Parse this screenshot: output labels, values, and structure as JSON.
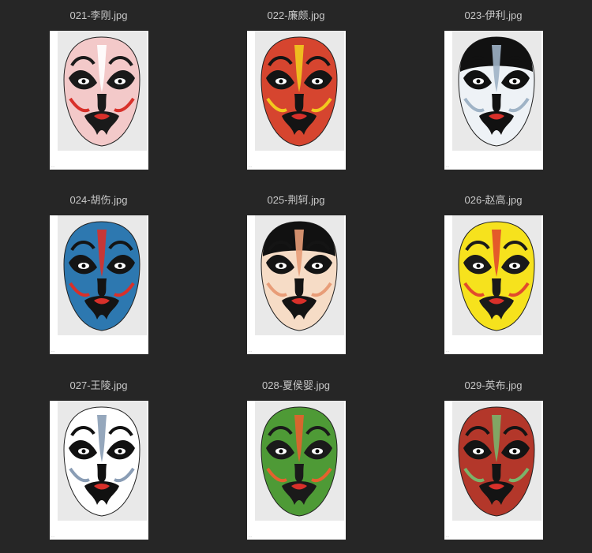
{
  "files": [
    {
      "name": "021-李刚.jpg",
      "base": "#f3c9c9",
      "accent": "#d8302a",
      "dark": "#1a1a1a",
      "forehead": "#ffffff",
      "cap": false
    },
    {
      "name": "022-廉颇.jpg",
      "base": "#d6452f",
      "accent": "#f2c91e",
      "dark": "#141414",
      "forehead": "#d6452f",
      "cap": false
    },
    {
      "name": "023-伊利.jpg",
      "base": "#eef2f6",
      "accent": "#9fb3c6",
      "dark": "#111111",
      "forehead": "#eef2f6",
      "cap": true
    },
    {
      "name": "024-胡伤.jpg",
      "base": "#2d78b0",
      "accent": "#d8302a",
      "dark": "#141414",
      "forehead": "#2d78b0",
      "cap": false
    },
    {
      "name": "025-荆轲.jpg",
      "base": "#f6dcc6",
      "accent": "#e89d78",
      "dark": "#141414",
      "forehead": "#f6dcc6",
      "cap": true
    },
    {
      "name": "026-赵高.jpg",
      "base": "#f6e21d",
      "accent": "#e24b2c",
      "dark": "#1a1a1a",
      "forehead": "#f6e21d",
      "cap": false
    },
    {
      "name": "027-王陵.jpg",
      "base": "#ffffff",
      "accent": "#8a9db5",
      "dark": "#111111",
      "forehead": "#ffffff",
      "cap": false
    },
    {
      "name": "028-夏侯婴.jpg",
      "base": "#4e9a36",
      "accent": "#e5622e",
      "dark": "#1a1a1a",
      "forehead": "#e5622e",
      "cap": false
    },
    {
      "name": "029-英布.jpg",
      "base": "#b3372a",
      "accent": "#7bb36a",
      "dark": "#141414",
      "forehead": "#b3372a",
      "cap": false
    }
  ]
}
